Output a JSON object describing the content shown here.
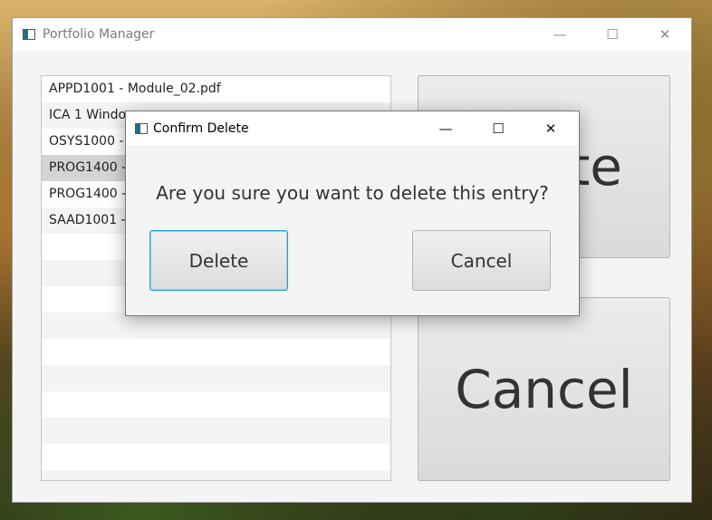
{
  "main_window": {
    "title": "Portfolio Manager",
    "controls": {
      "minimize": "—",
      "maximize": "☐",
      "close": "✕"
    },
    "list_items": [
      "APPD1001 - Module_02.pdf",
      "ICA 1 Windo",
      "OSYS1000 - I",
      "PROG1400 -",
      "PROG1400 -",
      "SAAD1001 -"
    ],
    "buttons": {
      "delete_partial": "te",
      "cancel": "Cancel"
    }
  },
  "dialog": {
    "title": "Confirm Delete",
    "controls": {
      "minimize": "—",
      "maximize": "☐",
      "close": "✕"
    },
    "message": "Are you sure you want to delete this entry?",
    "delete_label": "Delete",
    "cancel_label": "Cancel"
  }
}
